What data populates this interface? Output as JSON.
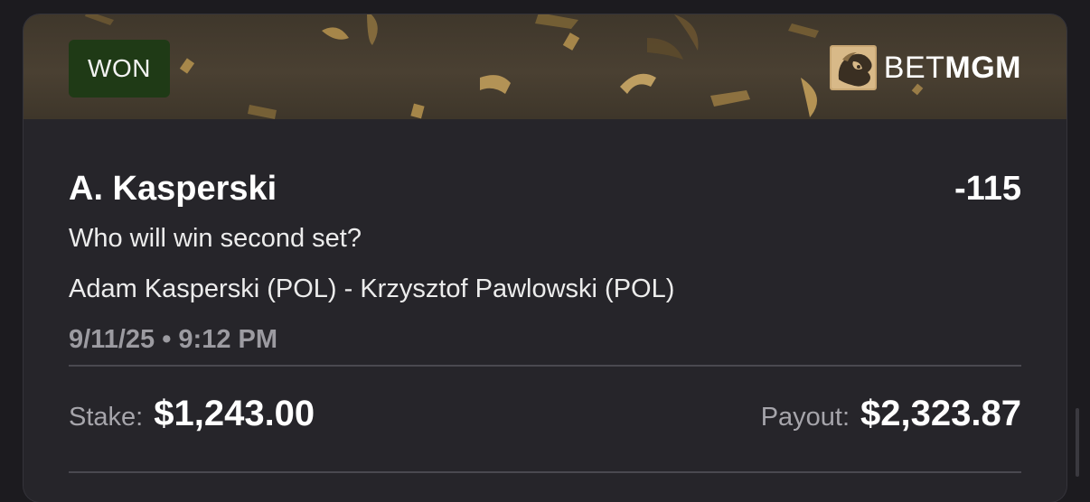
{
  "bet": {
    "status": "WON",
    "brand": {
      "first": "BET",
      "second": "MGM"
    },
    "selection": "A. Kasperski",
    "odds": "-115",
    "market": "Who will win second set?",
    "event": "Adam Kasperski (POL) - Krzysztof Pawlowski (POL)",
    "datetime": "9/11/25 • 9:12 PM",
    "stake_label": "Stake:",
    "stake_value": "$1,243.00",
    "payout_label": "Payout:",
    "payout_value": "$2,323.87"
  },
  "colors": {
    "won_badge": "#1f3a16",
    "banner_gold": "#c9a45c",
    "card_bg": "#26252a",
    "page_bg": "#1c1b1f"
  },
  "icons": {
    "brand_logo": "lion-logo-icon"
  }
}
